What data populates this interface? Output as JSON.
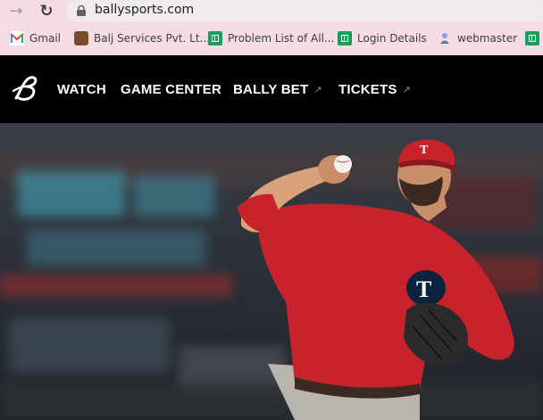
{
  "browser": {
    "url": "ballysports.com",
    "bookmarks": [
      {
        "label": "Gmail",
        "icon": "gmail-icon"
      },
      {
        "label": "Balj Services Pvt. Lt...",
        "icon": "balj-favicon"
      },
      {
        "label": "Problem List of All...",
        "icon": "sheets-icon"
      },
      {
        "label": "Login Details",
        "icon": "sheets-icon"
      },
      {
        "label": "webmaster",
        "icon": "webmaster-icon"
      }
    ]
  },
  "site": {
    "nav": {
      "watch": "WATCH",
      "game_center": "GAME CENTER",
      "bally_bet": "BALLY BET",
      "tickets": "TICKETS",
      "external_glyph": "↗"
    }
  },
  "colors": {
    "chrome_bg": "#f5dbe3",
    "header_bg": "#000000",
    "jersey_red": "#c8232c"
  }
}
